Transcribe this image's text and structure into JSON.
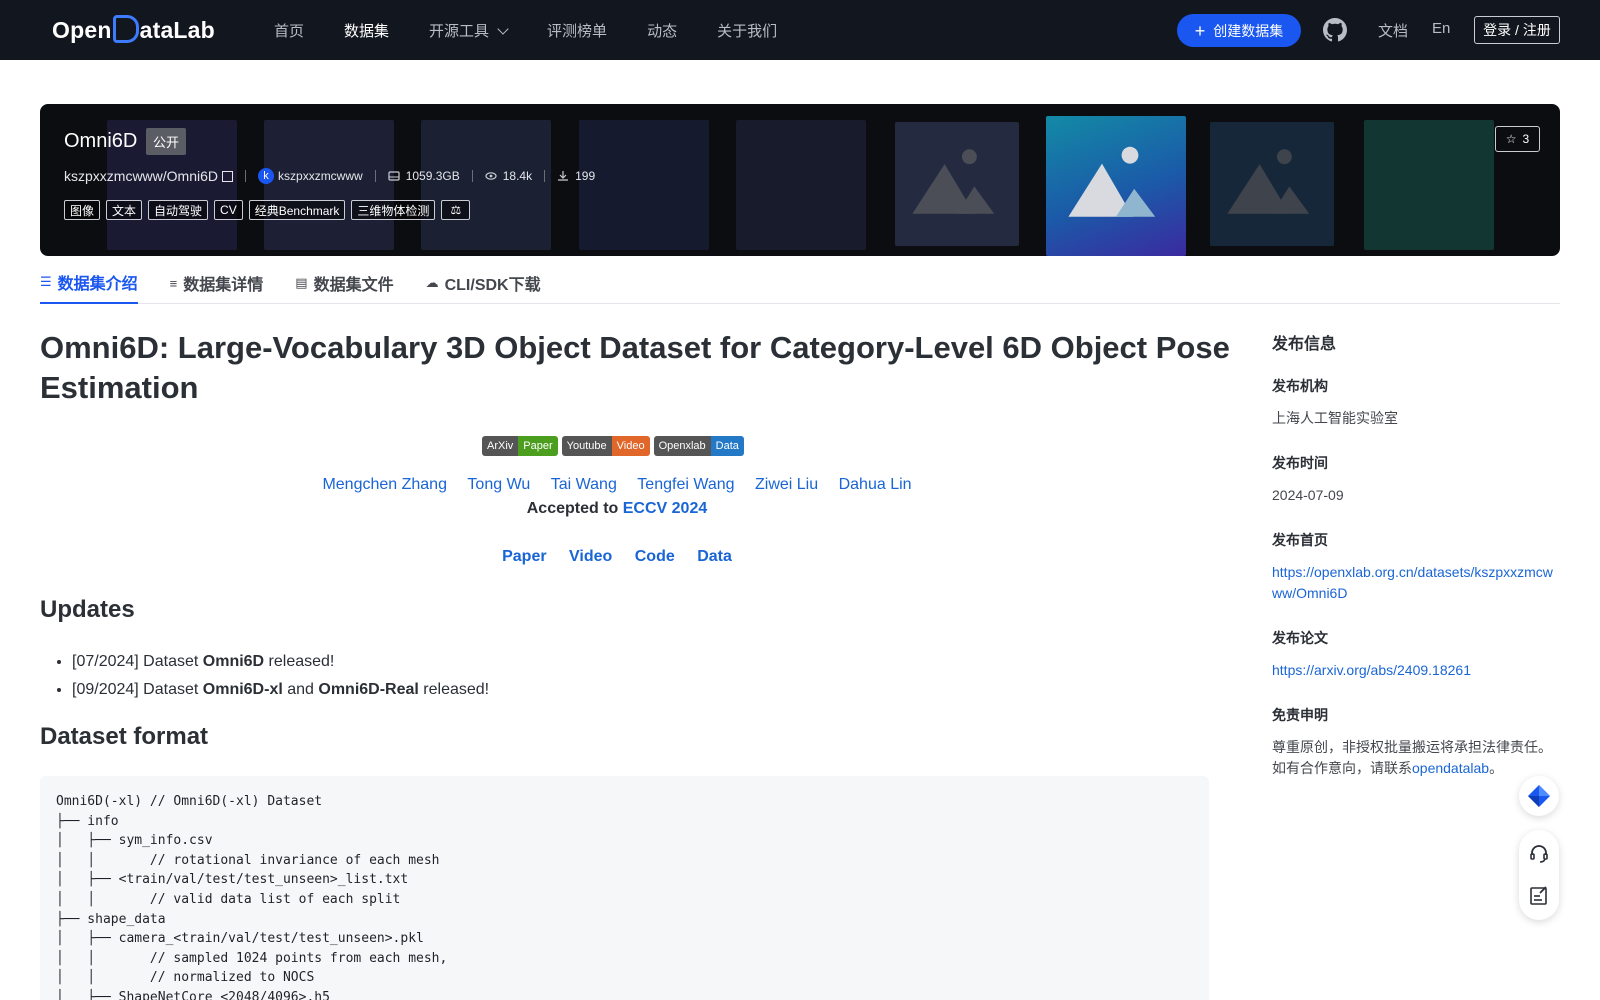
{
  "nav": {
    "logo": "OpenDataLab",
    "logo_left": "Open",
    "logo_right": "ataLab",
    "links": [
      "首页",
      "数据集",
      "开源工具",
      "评测榜单",
      "动态",
      "关于我们"
    ],
    "create_label": "创建数据集",
    "docs_label": "文档",
    "lang_label": "En",
    "login_label": "登录 / 注册"
  },
  "hero": {
    "title": "Omni6D",
    "visibility": "公开",
    "repo": "kszpxxzmcwww/Omni6D",
    "owner_initial": "k",
    "owner": "kszpxxzmcwww",
    "size": "1059.3GB",
    "views": "18.4k",
    "downloads": "199",
    "tags": [
      "图像",
      "文本",
      "自动驾驶",
      "CV",
      "经典Benchmark",
      "三维物体检测"
    ],
    "stars": "3"
  },
  "tabs": [
    {
      "icon": "☰",
      "label": "数据集介绍"
    },
    {
      "icon": "≡",
      "label": "数据集详情"
    },
    {
      "icon": "▤",
      "label": "数据集文件"
    },
    {
      "icon": "☁",
      "label": "CLI/SDK下载"
    }
  ],
  "main": {
    "title": "Omni6D: Large-Vocabulary 3D Object Dataset for Category-Level 6D Object Pose Estimation",
    "badges": [
      {
        "left": "ArXiv",
        "right": "Paper",
        "color": "#4c9e1f"
      },
      {
        "left": "Youtube",
        "right": "Video",
        "color": "#e0662a"
      },
      {
        "left": "Openxlab",
        "right": "Data",
        "color": "#2479c7"
      }
    ],
    "authors": [
      "Mengchen Zhang",
      "Tong Wu",
      "Tai Wang",
      "Tengfei Wang",
      "Ziwei Liu",
      "Dahua Lin"
    ],
    "accepted_prefix": "Accepted to ",
    "accepted_venue": "ECCV 2024",
    "links": [
      "Paper",
      "Video",
      "Code",
      "Data"
    ],
    "updates_heading": "Updates",
    "updates": [
      {
        "a": "[07/2024] Dataset ",
        "b": "Omni6D",
        "c": " released!",
        "d": "",
        "e": ""
      },
      {
        "a": "[09/2024] Dataset ",
        "b": "Omni6D-xl",
        "c": " and ",
        "d": "Omni6D-Real",
        "e": " released!"
      }
    ],
    "format_heading": "Dataset format",
    "code": "Omni6D(-xl) // Omni6D(-xl) Dataset\n├── info\n│   ├── sym_info.csv\n│   │       // rotational invariance of each mesh\n│   ├── <train/val/test/test_unseen>_list.txt\n│   │       // valid data list of each split\n├── shape_data\n│   ├── camera_<train/val/test/test_unseen>.pkl\n│   │       // sampled 1024 points from each mesh,\n│   │       // normalized to NOCS\n│   ├── ShapeNetCore_<2048/4096>.h5"
  },
  "sidebar": {
    "heading": "发布信息",
    "org_label": "发布机构",
    "org": "上海人工智能实验室",
    "date_label": "发布时间",
    "date": "2024-07-09",
    "home_label": "发布首页",
    "home": "https://openxlab.org.cn/datasets/kszpxxzmcwww/Omni6D",
    "paper_label": "发布论文",
    "paper": "https://arxiv.org/abs/2409.18261",
    "disclaimer_label": "免责申明",
    "disclaimer_1": "尊重原创，非授权批量搬运将承担法律责任。",
    "disclaimer_2": "如有合作意向，请联系",
    "disclaimer_link": "opendatalab",
    "disclaimer_end": "。"
  },
  "colors": {
    "accent": "#1a56f0",
    "nav_bg": "#12161f",
    "link": "#1a65d6"
  },
  "icons": {
    "github": "github-icon",
    "star": "star-icon",
    "disk": "disk-icon",
    "eye": "eye-icon",
    "download": "download-icon",
    "scale": "scale-icon"
  }
}
